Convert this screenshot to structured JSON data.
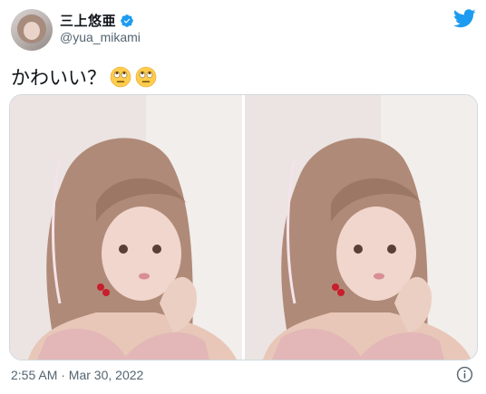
{
  "tweet": {
    "author": {
      "display_name": "三上悠亜",
      "handle": "@yua_mikami",
      "verified": true
    },
    "text": "かわいい？",
    "emojis": [
      "face-with-rolling-eyes",
      "face-with-rolling-eyes"
    ],
    "media": [
      {
        "type": "photo",
        "subject": "woman-with-twin-tails-pink-top"
      },
      {
        "type": "photo",
        "subject": "woman-with-twin-tails-pink-top"
      }
    ],
    "timestamp": "2:55 AM · Mar 30, 2022"
  },
  "colors": {
    "twitter_blue": "#1d9bf0",
    "secondary_text": "#536471",
    "primary_text": "#0f1419",
    "border": "#cfd9de"
  },
  "icons": {
    "logo": "twitter-bird-icon",
    "verified": "verified-badge-icon",
    "info": "info-icon"
  }
}
